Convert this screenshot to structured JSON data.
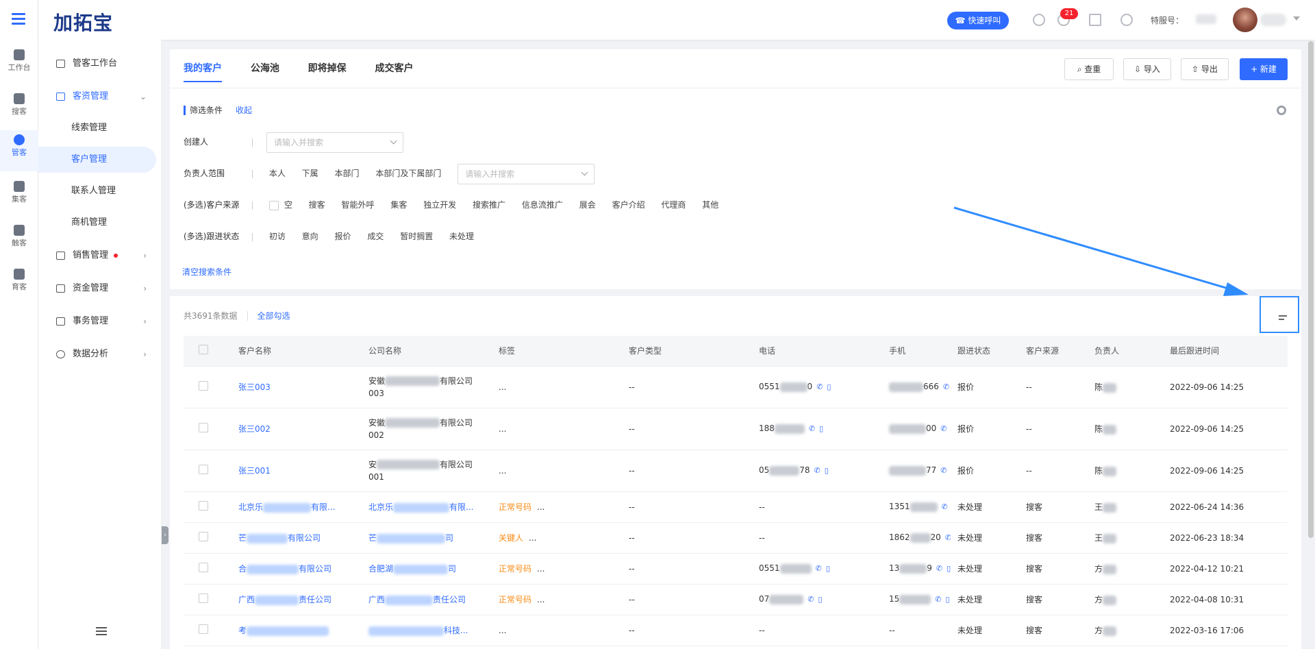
{
  "app": {
    "logo": "加拓宝"
  },
  "rail": {
    "items": [
      {
        "label": "工作台"
      },
      {
        "label": "搜客"
      },
      {
        "label": "管客"
      },
      {
        "label": "集客"
      },
      {
        "label": "触客"
      },
      {
        "label": "育客"
      }
    ]
  },
  "header": {
    "quick_call": "快速呼叫",
    "badge": "21",
    "service_label": "特服号："
  },
  "sidebar": {
    "items": [
      {
        "label": "管客工作台"
      },
      {
        "label": "客资管理"
      },
      {
        "label": "线索管理"
      },
      {
        "label": "客户管理"
      },
      {
        "label": "联系人管理"
      },
      {
        "label": "商机管理"
      },
      {
        "label": "销售管理"
      },
      {
        "label": "资金管理"
      },
      {
        "label": "事务管理"
      },
      {
        "label": "数据分析"
      }
    ]
  },
  "tabs": [
    "我的客户",
    "公海池",
    "即将掉保",
    "成交客户"
  ],
  "toolbar": {
    "dedupe": "查重",
    "import": "导入",
    "export": "导出",
    "create": "+ 新建"
  },
  "filters": {
    "title": "筛选条件",
    "collapse": "收起",
    "creator_label": "创建人",
    "creator_placeholder": "请输入并搜索",
    "owner_label": "负责人范围",
    "owner_options": [
      "本人",
      "下属",
      "本部门",
      "本部门及下属部门"
    ],
    "owner_placeholder": "请输入并搜索",
    "source_label": "(多选)客户来源",
    "source_options": [
      "空",
      "搜客",
      "智能外呼",
      "集客",
      "独立开发",
      "搜索推广",
      "信息流推广",
      "展会",
      "客户介绍",
      "代理商",
      "其他"
    ],
    "status_label": "(多选)跟进状态",
    "status_options": [
      "初访",
      "意向",
      "报价",
      "成交",
      "暂时搁置",
      "未处理"
    ],
    "clear": "清空搜索条件"
  },
  "list": {
    "total": "共3691条数据",
    "select_all": "全部勾选",
    "columns": [
      "客户名称",
      "公司名称",
      "标签",
      "客户类型",
      "电话",
      "手机",
      "跟进状态",
      "客户来源",
      "负责人",
      "最后跟进时间"
    ],
    "rows": [
      {
        "name": "张三003",
        "company_a": "安徽",
        "company_b": "有限公司",
        "company_c": "003",
        "tag": "...",
        "type": "--",
        "phone": "0551",
        "phone_tail": "0",
        "mobile_tail": "666",
        "status": "报价",
        "source": "--",
        "owner": "陈",
        "time": "2022-09-06 14:25"
      },
      {
        "name": "张三002",
        "company_a": "安徽",
        "company_b": "有限公司",
        "company_c": "002",
        "tag": "...",
        "type": "--",
        "phone": "188",
        "phone_tail": "",
        "mobile_tail": "00",
        "status": "报价",
        "source": "--",
        "owner": "陈",
        "time": "2022-09-06 14:25"
      },
      {
        "name": "张三001",
        "company_a": "安",
        "company_b": "有限公司",
        "company_c": "001",
        "tag": "...",
        "type": "--",
        "phone": "05",
        "phone_tail": "78",
        "mobile_tail": "77",
        "status": "报价",
        "source": "--",
        "owner": "陈",
        "time": "2022-09-06 14:25"
      },
      {
        "name": "北京乐",
        "name_tail": "有限...",
        "company": "北京乐",
        "company_tail": "有限...",
        "tag": "正常号码",
        "type": "--",
        "phone": "--",
        "mobile": "1351",
        "status": "未处理",
        "source": "搜客",
        "owner": "王",
        "time": "2022-06-24 14:36"
      },
      {
        "name": "芒",
        "name_tail": "有限公司",
        "company": "芒",
        "company_tail": "司",
        "tag": "关键人",
        "type": "--",
        "phone": "--",
        "mobile": "1862",
        "mobile_tail": "20",
        "status": "未处理",
        "source": "搜客",
        "owner": "王",
        "time": "2022-06-23 18:34"
      },
      {
        "name": "合",
        "name_tail": "有限公司",
        "company": "合肥湖",
        "company_tail": "司",
        "tag": "正常号码",
        "type": "--",
        "phone": "0551",
        "mobile": "13",
        "mobile_tail": "9",
        "status": "未处理",
        "source": "搜客",
        "owner": "方",
        "time": "2022-04-12 10:21"
      },
      {
        "name": "广西",
        "name_tail": "责任公司",
        "company": "广西",
        "company_tail": "责任公司",
        "tag": "正常号码",
        "type": "--",
        "phone": "07",
        "mobile": "15",
        "status": "未处理",
        "source": "搜客",
        "owner": "方",
        "time": "2022-04-08 10:31"
      },
      {
        "name": "考",
        "name_tail": "",
        "company": "",
        "company_tail": "科技...",
        "tag": "...",
        "type": "--",
        "phone": "--",
        "mobile": "--",
        "status": "未处理",
        "source": "搜客",
        "owner": "方",
        "time": "2022-03-16 17:06"
      }
    ]
  }
}
